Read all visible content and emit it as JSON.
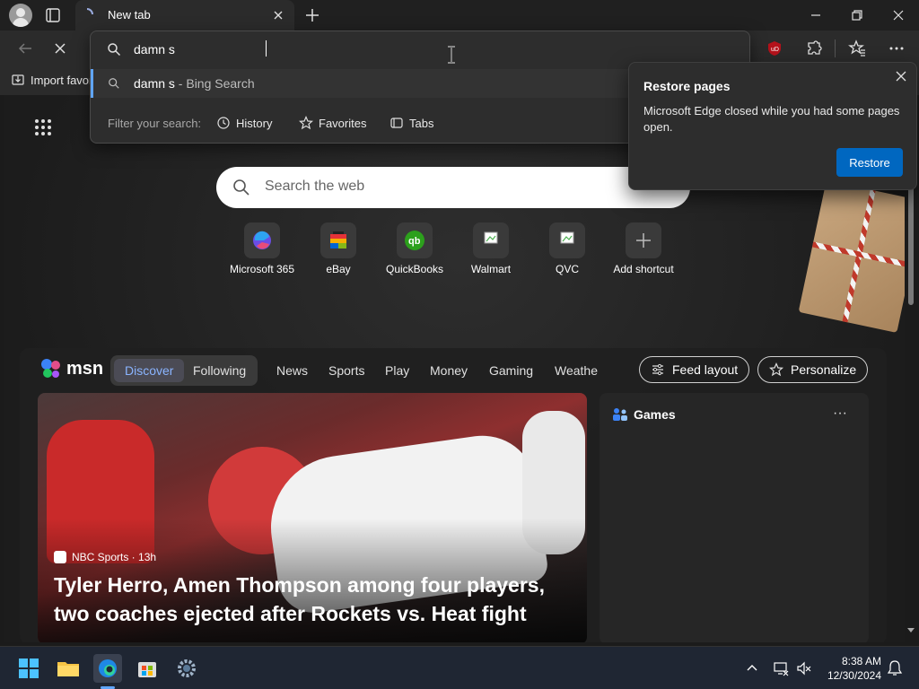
{
  "browser": {
    "tab": {
      "title": "New tab"
    },
    "favorites_bar": {
      "item": "Import favor"
    }
  },
  "omnibox": {
    "value": "damn s",
    "suggestion": {
      "query": "damn s",
      "suffix": " - Bing Search"
    },
    "filter": {
      "label": "Filter your search:",
      "chips": [
        "History",
        "Favorites",
        "Tabs"
      ]
    }
  },
  "restore_popup": {
    "title": "Restore pages",
    "message": "Microsoft Edge closed while you had some pages open.",
    "button": "Restore"
  },
  "page": {
    "search": {
      "placeholder": "Search the web"
    },
    "shortcuts": [
      {
        "label": "Microsoft 365"
      },
      {
        "label": "eBay"
      },
      {
        "label": "QuickBooks"
      },
      {
        "label": "Walmart"
      },
      {
        "label": "QVC"
      },
      {
        "label": "Add shortcut"
      }
    ]
  },
  "msn": {
    "logo": "msn",
    "tabs": [
      "Discover",
      "Following"
    ],
    "nav": [
      "News",
      "Sports",
      "Play",
      "Money",
      "Gaming",
      "Weathe"
    ],
    "buttons": {
      "feed_layout": "Feed layout",
      "personalize": "Personalize"
    },
    "hero": {
      "source": "NBC Sports · 13h",
      "headline": "Tyler Herro, Amen Thompson among four players, two coaches ejected after Rockets vs. Heat fight"
    },
    "games": {
      "title": "Games",
      "more": "···"
    }
  },
  "taskbar": {
    "time": "8:38 AM",
    "date": "12/30/2024"
  },
  "colors": {
    "accent_blue": "#0067c0",
    "link_blue": "#8ab4ff",
    "dark_bg": "#202020"
  }
}
